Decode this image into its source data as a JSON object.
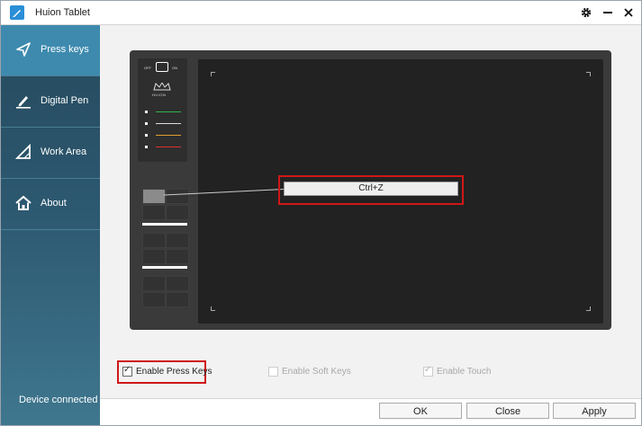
{
  "window": {
    "title": "Huion Tablet"
  },
  "sidebar": {
    "items": [
      {
        "label": "Press keys",
        "icon": "send-arrow-icon",
        "active": true
      },
      {
        "label": "Digital Pen",
        "icon": "pen-icon",
        "active": false
      },
      {
        "label": "Work Area",
        "icon": "triangle-ruler-icon",
        "active": false
      },
      {
        "label": "About",
        "icon": "home-icon",
        "active": false
      }
    ],
    "status": "Device connected"
  },
  "tablet": {
    "brand_logo": "HUION",
    "mode_off": "OFF",
    "mode_on": "ON",
    "selected_key_value": "Ctrl+Z"
  },
  "options": {
    "enable_press_keys": {
      "label": "Enable Press Keys",
      "checked": true,
      "enabled": true
    },
    "enable_soft_keys": {
      "label": "Enable Soft Keys",
      "checked": false,
      "enabled": false
    },
    "enable_touch": {
      "label": "Enable Touch",
      "checked": true,
      "enabled": false
    }
  },
  "buttons": {
    "ok": "OK",
    "close": "Close",
    "apply": "Apply"
  },
  "colors": {
    "sidebar_active": "#3e8aae",
    "highlight": "#d01717",
    "accent": "#2a8fd6"
  }
}
